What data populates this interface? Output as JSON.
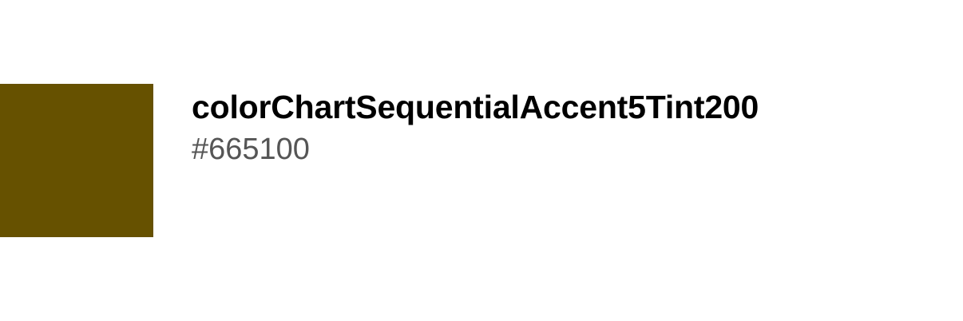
{
  "token": {
    "name": "colorChartSequentialAccent5Tint200",
    "hex": "#665100",
    "swatch_color": "#665100"
  }
}
